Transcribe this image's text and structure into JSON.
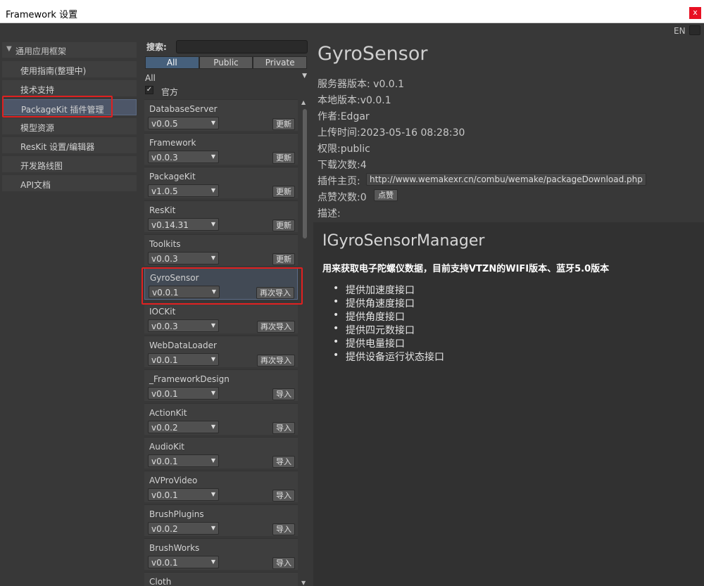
{
  "window": {
    "title": "Framework 设置",
    "close_label": "x"
  },
  "lang": {
    "label": "EN"
  },
  "nav": {
    "group_label": "通用应用框架",
    "items": [
      {
        "label": "使用指南(整理中)"
      },
      {
        "label": "技术支持"
      },
      {
        "label": "PackageKit 插件管理",
        "active": true
      },
      {
        "label": "模型资源"
      },
      {
        "label": "ResKit 设置/编辑器"
      },
      {
        "label": "开发路线图"
      },
      {
        "label": "API文档"
      }
    ]
  },
  "list": {
    "search_label": "搜索:",
    "search_value": "",
    "tabs": [
      "All",
      "Public",
      "Private"
    ],
    "selected_tab": "All",
    "filter_value": "All",
    "official_checked": true,
    "official_label": "官方",
    "packages": [
      {
        "name": "DatabaseServer",
        "version": "v0.0.5",
        "action": "更新"
      },
      {
        "name": "Framework",
        "version": "v0.0.3",
        "action": "更新"
      },
      {
        "name": "PackageKit",
        "version": "v1.0.5",
        "action": "更新"
      },
      {
        "name": "ResKit",
        "version": "v0.14.31",
        "action": "更新"
      },
      {
        "name": "Toolkits",
        "version": "v0.0.3",
        "action": "更新"
      },
      {
        "name": "GyroSensor",
        "version": "v0.0.1",
        "action": "再次导入",
        "selected": true
      },
      {
        "name": "IOCKit",
        "version": "v0.0.3",
        "action": "再次导入"
      },
      {
        "name": "WebDataLoader",
        "version": "v0.0.1",
        "action": "再次导入"
      },
      {
        "name": "_FrameworkDesign",
        "version": "v0.0.1",
        "action": "导入"
      },
      {
        "name": "ActionKit",
        "version": "v0.0.2",
        "action": "导入"
      },
      {
        "name": "AudioKit",
        "version": "v0.0.1",
        "action": "导入"
      },
      {
        "name": "AVProVideo",
        "version": "v0.0.1",
        "action": "导入"
      },
      {
        "name": "BrushPlugins",
        "version": "v0.0.2",
        "action": "导入"
      },
      {
        "name": "BrushWorks",
        "version": "v0.0.1",
        "action": "导入"
      },
      {
        "name": "Cloth",
        "version": "",
        "action": ""
      }
    ]
  },
  "detail": {
    "title": "GyroSensor",
    "server_version": "服务器版本: v0.0.1",
    "local_version": "本地版本:v0.0.1",
    "author": "作者:Edgar",
    "upload_time": "上传时间:2023-05-16 08:28:30",
    "access": "权限:public",
    "downloads": "下载次数:4",
    "homepage_label": "插件主页:",
    "homepage_url": "http://www.wemakexr.cn/combu/wemake/packageDownload.php",
    "likes_label": "点赞次数:0",
    "like_button": "点赞",
    "desc_label": "描述:",
    "readme": {
      "title": "IGyroSensorManager",
      "subtitle": "用来获取电子陀螺仪数据，目前支持VTZN的WIFI版本、蓝牙5.0版本",
      "features": [
        "提供加速度接口",
        "提供角速度接口",
        "提供角度接口",
        "提供四元数接口",
        "提供电量接口",
        "提供设备运行状态接口"
      ]
    }
  }
}
